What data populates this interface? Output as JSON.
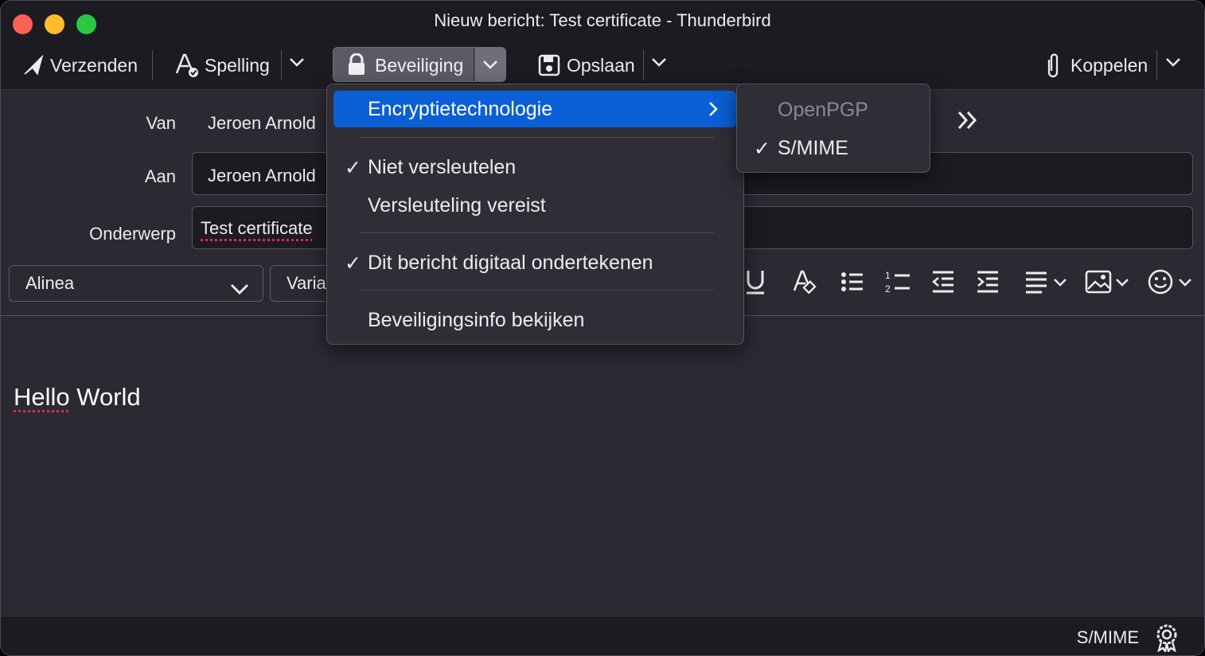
{
  "window": {
    "title": "Nieuw bericht: Test certificate - Thunderbird"
  },
  "toolbar": {
    "send_label": "Verzenden",
    "spelling_label": "Spelling",
    "security_label": "Beveiliging",
    "save_label": "Opslaan",
    "attach_label": "Koppelen"
  },
  "header": {
    "from_label": "Van",
    "from_value": "Jeroen Arnold",
    "to_label": "Aan",
    "to_value": "Jeroen Arnold",
    "subject_label": "Onderwerp",
    "subject_value": "Test certificate"
  },
  "format": {
    "paragraph_value": "Alinea",
    "font_value": "Varia"
  },
  "body": {
    "text_1": "Hello",
    "text_2": "World"
  },
  "security_menu": {
    "items": [
      {
        "label": "Encryptietechnologie",
        "checked": false,
        "submenu": true
      },
      {
        "label": "Niet versleutelen",
        "checked": true
      },
      {
        "label": "Versleuteling vereist",
        "checked": false
      },
      {
        "label": "Dit bericht digitaal ondertekenen",
        "checked": true
      },
      {
        "label": "Beveiligingsinfo bekijken",
        "checked": false
      }
    ],
    "check_mark": "✓"
  },
  "encryption_submenu": {
    "items": [
      {
        "label": "OpenPGP",
        "checked": false,
        "disabled": true
      },
      {
        "label": "S/MIME",
        "checked": true
      }
    ]
  },
  "status": {
    "security_text": "S/MIME"
  },
  "colors": {
    "highlight": "#0a5fd6",
    "background": "#2b2a33",
    "toolbar": "#1c1b22",
    "spell_error": "#e22850"
  }
}
